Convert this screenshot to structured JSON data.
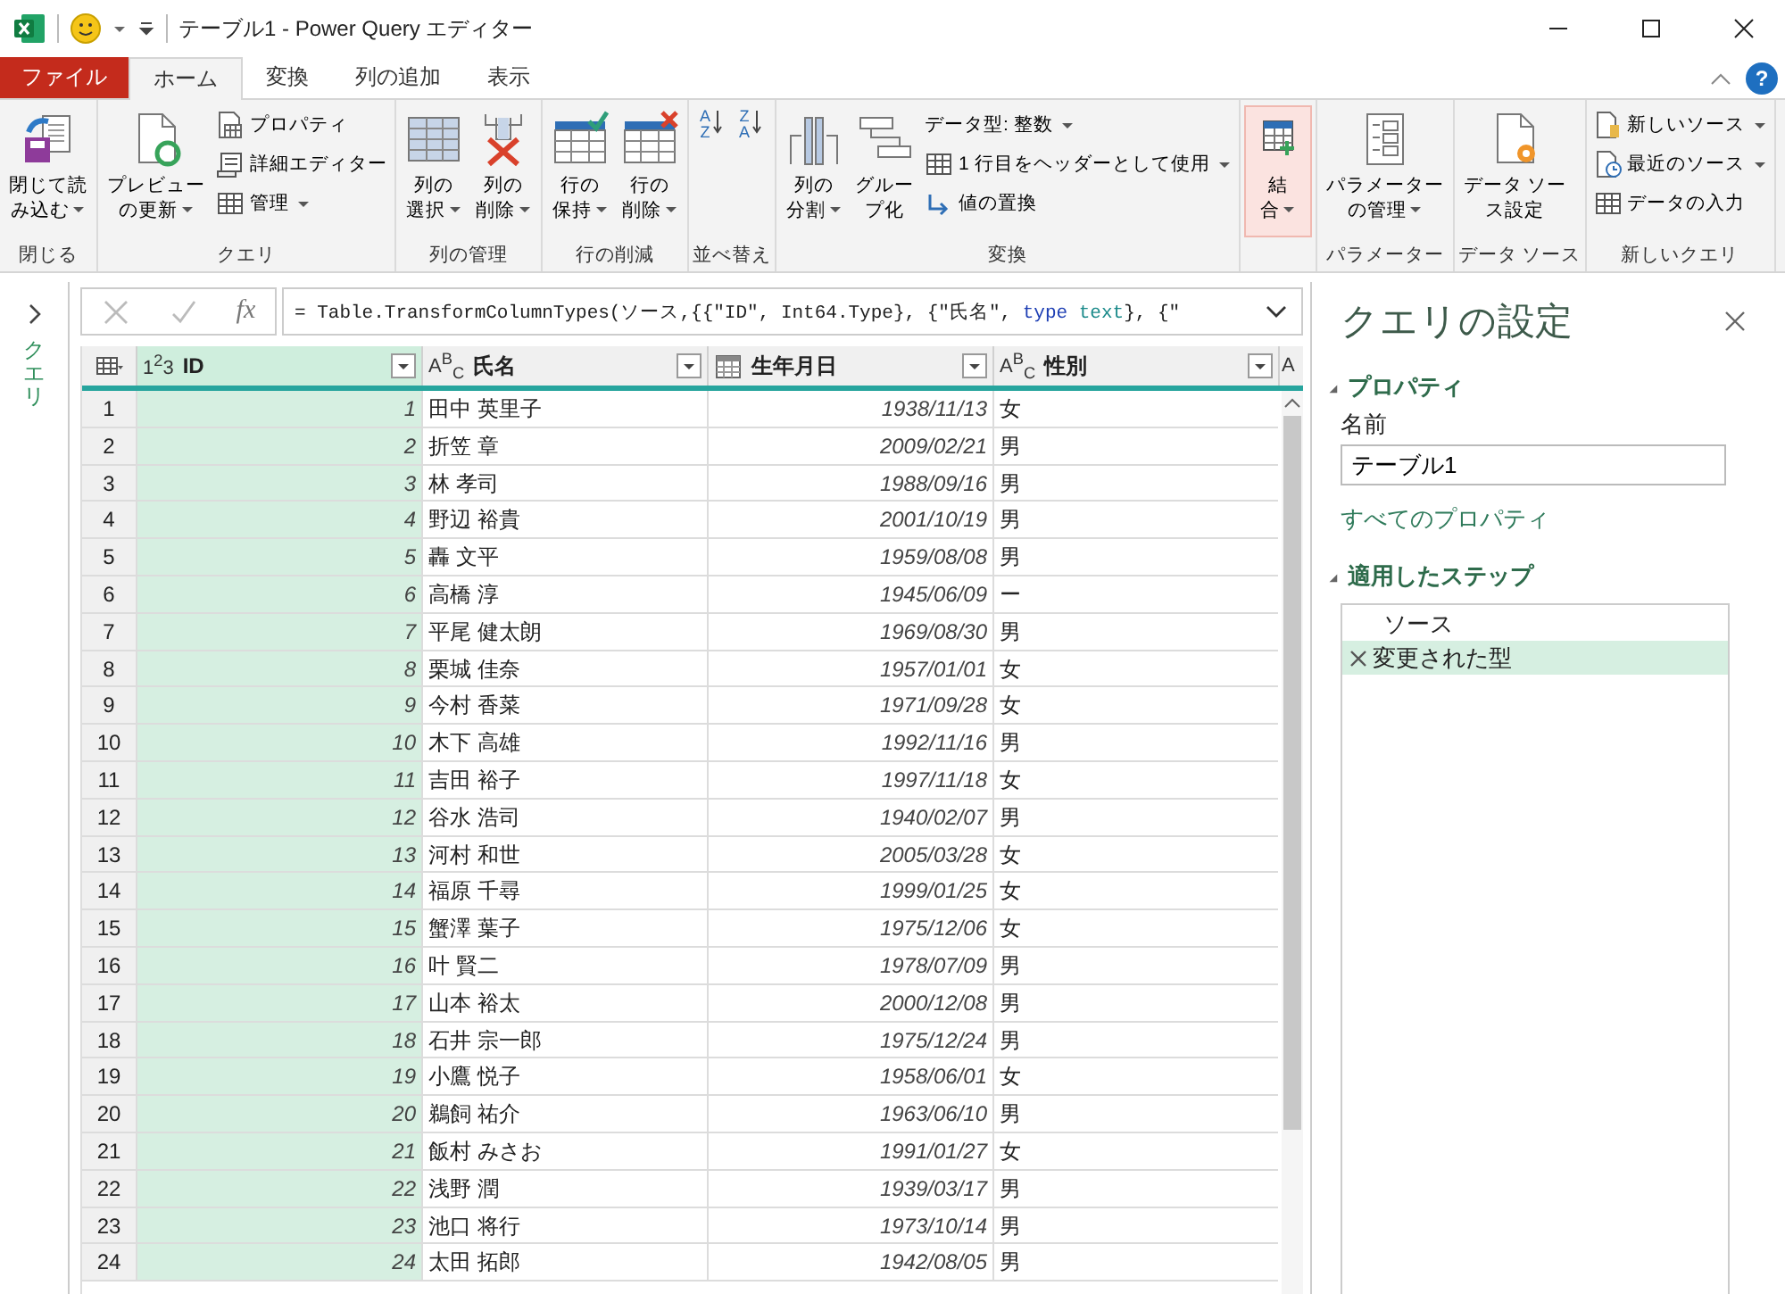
{
  "window": {
    "title": "テーブル1 - Power Query エディター"
  },
  "ribbon_tabs": [
    {
      "label": "ファイル",
      "kind": "file",
      "selected": false
    },
    {
      "label": "ホーム",
      "kind": "tab",
      "selected": true
    },
    {
      "label": "変換",
      "kind": "tab",
      "selected": false
    },
    {
      "label": "列の追加",
      "kind": "tab",
      "selected": false
    },
    {
      "label": "表示",
      "kind": "tab",
      "selected": false
    }
  ],
  "help_label": "?",
  "ribbon_groups": [
    {
      "label": "閉じる",
      "items": [
        {
          "kind": "large",
          "lines": [
            "閉じて読",
            "み込む"
          ],
          "dropdown": true
        }
      ]
    },
    {
      "label": "クエリ",
      "items": [
        {
          "kind": "large",
          "lines": [
            "プレビュー",
            "の更新"
          ],
          "dropdown": true
        },
        {
          "kind": "small",
          "label": "プロパティ",
          "dropdown": false
        },
        {
          "kind": "small",
          "label": "詳細エディター",
          "dropdown": false
        },
        {
          "kind": "small",
          "label": "管理",
          "dropdown": true
        }
      ]
    },
    {
      "label": "列の管理",
      "items": [
        {
          "kind": "large",
          "lines": [
            "列の",
            "選択"
          ],
          "dropdown": true
        },
        {
          "kind": "large",
          "lines": [
            "列の",
            "削除"
          ],
          "dropdown": true
        }
      ]
    },
    {
      "label": "行の削減",
      "items": [
        {
          "kind": "large",
          "lines": [
            "行の",
            "保持"
          ],
          "dropdown": true
        },
        {
          "kind": "large",
          "lines": [
            "行の",
            "削除"
          ],
          "dropdown": true
        }
      ]
    },
    {
      "label": "並べ替え",
      "items": [
        {
          "kind": "sort",
          "top": "A",
          "bottom": "Z"
        },
        {
          "kind": "sort",
          "top": "Z",
          "bottom": "A"
        }
      ]
    },
    {
      "label": "変換",
      "items": [
        {
          "kind": "large",
          "lines": [
            "列の",
            "分割"
          ],
          "dropdown": true
        },
        {
          "kind": "large",
          "lines": [
            "グルー",
            "プ化"
          ],
          "dropdown": false
        },
        {
          "kind": "small",
          "label": "データ型: 整数",
          "dropdown": true
        },
        {
          "kind": "small",
          "label": "1 行目をヘッダーとして使用",
          "dropdown": true
        },
        {
          "kind": "small",
          "label": "値の置換",
          "dropdown": false
        }
      ]
    },
    {
      "items": [
        {
          "kind": "large",
          "lines": [
            "結",
            "合"
          ],
          "dropdown": true,
          "highlighted": true
        }
      ]
    },
    {
      "label": "パラメーター",
      "items": [
        {
          "kind": "large",
          "lines": [
            "パラメーター",
            "の管理"
          ],
          "dropdown": true
        }
      ]
    },
    {
      "label": "データ ソース",
      "items": [
        {
          "kind": "large",
          "lines": [
            "データ ソー",
            "ス設定"
          ],
          "dropdown": false
        }
      ]
    },
    {
      "label": "新しいクエリ",
      "items": [
        {
          "kind": "small",
          "label": "新しいソース",
          "dropdown": true
        },
        {
          "kind": "small",
          "label": "最近のソース",
          "dropdown": true
        },
        {
          "kind": "small",
          "label": "データの入力",
          "dropdown": false
        }
      ]
    }
  ],
  "queries_pane": {
    "label": "クエリ",
    "expanded": false
  },
  "formula_bar": {
    "function_symbol": "fx",
    "formula": [
      {
        "text": "= Table.TransformColumnTypes(ソース,{{\"ID\", Int64.Type}, {\"氏名\", ",
        "kind": "plain"
      },
      {
        "text": "type",
        "kind": "keyword"
      },
      {
        "text": " text",
        "kind": "type"
      },
      {
        "text": "}, {\"",
        "kind": "plain"
      }
    ]
  },
  "table": {
    "columns": [
      {
        "name": "ID",
        "kind": "number",
        "type_label": "1$^{2}$3",
        "selected": true
      },
      {
        "name": "氏名",
        "kind": "text",
        "type_label": "A$^{B}$$_{C}$",
        "selected": false
      },
      {
        "name": "生年月日",
        "kind": "date",
        "selected": false
      },
      {
        "name": "性別",
        "kind": "text",
        "type_label": "A$^{B}$$_{C}$",
        "selected": false
      },
      {
        "kind": "text",
        "type_label": "A",
        "selected": false
      }
    ],
    "rows": [
      {
        "row_number": "1",
        "id": "1",
        "name": "田中 英里子",
        "birthdate": "1938/11/13",
        "gender": "女"
      },
      {
        "row_number": "2",
        "id": "2",
        "name": "折笠 章",
        "birthdate": "2009/02/21",
        "gender": "男"
      },
      {
        "row_number": "3",
        "id": "3",
        "name": "林 孝司",
        "birthdate": "1988/09/16",
        "gender": "男"
      },
      {
        "row_number": "4",
        "id": "4",
        "name": "野辺 裕貴",
        "birthdate": "2001/10/19",
        "gender": "男"
      },
      {
        "row_number": "5",
        "id": "5",
        "name": "轟 文平",
        "birthdate": "1959/08/08",
        "gender": "男"
      },
      {
        "row_number": "6",
        "id": "6",
        "name": "高橋 淳",
        "birthdate": "1945/06/09",
        "gender": "ー"
      },
      {
        "row_number": "7",
        "id": "7",
        "name": "平尾 健太朗",
        "birthdate": "1969/08/30",
        "gender": "男"
      },
      {
        "row_number": "8",
        "id": "8",
        "name": "栗城 佳奈",
        "birthdate": "1957/01/01",
        "gender": "女"
      },
      {
        "row_number": "9",
        "id": "9",
        "name": "今村 香菜",
        "birthdate": "1971/09/28",
        "gender": "女"
      },
      {
        "row_number": "10",
        "id": "10",
        "name": "木下 高雄",
        "birthdate": "1992/11/16",
        "gender": "男"
      },
      {
        "row_number": "11",
        "id": "11",
        "name": "吉田 裕子",
        "birthdate": "1997/11/18",
        "gender": "女"
      },
      {
        "row_number": "12",
        "id": "12",
        "name": "谷水 浩司",
        "birthdate": "1940/02/07",
        "gender": "男"
      },
      {
        "row_number": "13",
        "id": "13",
        "name": "河村 和世",
        "birthdate": "2005/03/28",
        "gender": "女"
      },
      {
        "row_number": "14",
        "id": "14",
        "name": "福原 千尋",
        "birthdate": "1999/01/25",
        "gender": "女"
      },
      {
        "row_number": "15",
        "id": "15",
        "name": "蟹澤 葉子",
        "birthdate": "1975/12/06",
        "gender": "女"
      },
      {
        "row_number": "16",
        "id": "16",
        "name": "叶 賢二",
        "birthdate": "1978/07/09",
        "gender": "男"
      },
      {
        "row_number": "17",
        "id": "17",
        "name": "山本 裕太",
        "birthdate": "2000/12/08",
        "gender": "男"
      },
      {
        "row_number": "18",
        "id": "18",
        "name": "石井 宗一郎",
        "birthdate": "1975/12/24",
        "gender": "男"
      },
      {
        "row_number": "19",
        "id": "19",
        "name": "小鷹 悦子",
        "birthdate": "1958/06/01",
        "gender": "女"
      },
      {
        "row_number": "20",
        "id": "20",
        "name": "鵜飼 祐介",
        "birthdate": "1963/06/10",
        "gender": "男"
      },
      {
        "row_number": "21",
        "id": "21",
        "name": "飯村 みさお",
        "birthdate": "1991/01/27",
        "gender": "女"
      },
      {
        "row_number": "22",
        "id": "22",
        "name": "浅野 潤",
        "birthdate": "1939/03/17",
        "gender": "男"
      },
      {
        "row_number": "23",
        "id": "23",
        "name": "池口 将行",
        "birthdate": "1973/10/14",
        "gender": "男"
      },
      {
        "row_number": "24",
        "id": "24",
        "name": "太田 拓郎",
        "birthdate": "1942/08/05",
        "gender": "男"
      }
    ]
  },
  "query_settings": {
    "title": "クエリの設定",
    "properties": {
      "heading": "プロパティ",
      "expanded": true,
      "name_label": "名前",
      "name_value": "テーブル1",
      "all_properties_link": "すべてのプロパティ"
    },
    "applied_steps": {
      "heading": "適用したステップ",
      "expanded": true,
      "steps": [
        {
          "label": "ソース",
          "selected": false
        },
        {
          "label": "変更された型",
          "selected": true
        }
      ]
    }
  }
}
